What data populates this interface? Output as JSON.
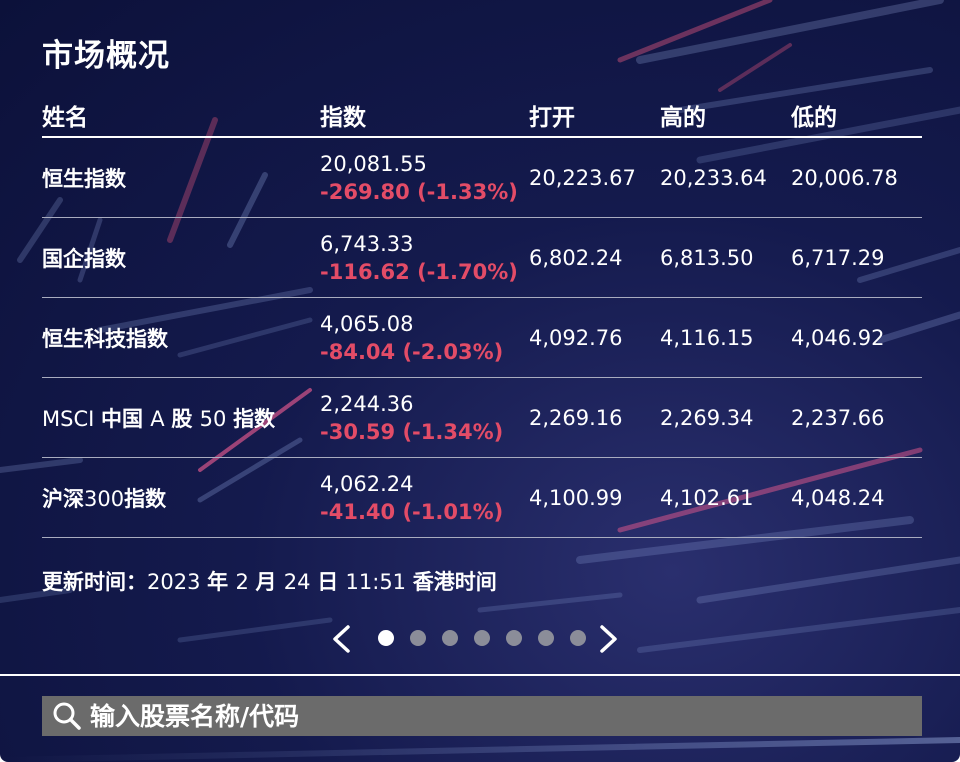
{
  "title": "市场概况",
  "columns": {
    "name": "姓名",
    "index": "指数",
    "open": "打开",
    "high": "高的",
    "low": "低的"
  },
  "rows": [
    {
      "name_cn": "恒生指数",
      "name_lat": "",
      "name_tail": "",
      "value": "20,081.55",
      "change": "-269.80 (-1.33%)",
      "open": "20,223.67",
      "high": "20,233.64",
      "low": "20,006.78"
    },
    {
      "name_cn": "国企指数",
      "name_lat": "",
      "name_tail": "",
      "value": "6,743.33",
      "change": "-116.62 (-1.70%)",
      "open": "6,802.24",
      "high": "6,813.50",
      "low": "6,717.29"
    },
    {
      "name_cn": "恒生科技指数",
      "name_lat": "",
      "name_tail": "",
      "value": "4,065.08",
      "change": "-84.04 (-2.03%)",
      "open": "4,092.76",
      "high": "4,116.15",
      "low": "4,046.92"
    },
    {
      "name_cn": "",
      "name_lat": "MSCI ",
      "name_mid": "中国 ",
      "name_lat2": "A ",
      "name_mid2": "股 ",
      "name_lat3": "50 ",
      "name_tail": "指数",
      "value": "2,244.36",
      "change": "-30.59 (-1.34%)",
      "open": "2,269.16",
      "high": "2,269.34",
      "low": "2,237.66"
    },
    {
      "name_cn": "沪深",
      "name_lat": "300",
      "name_tail": "指数",
      "value": "4,062.24",
      "change": "-41.40 (-1.01%)",
      "open": "4,100.99",
      "high": "4,102.61",
      "low": "4,048.24"
    }
  ],
  "updated": {
    "label": "更新时间：",
    "year": "2023 ",
    "year_unit": "年 ",
    "month": "2 ",
    "month_unit": "月 ",
    "day": "24 ",
    "day_unit": "日 ",
    "time": "11:51 ",
    "tz": "香港时间"
  },
  "pager": {
    "total": 7,
    "active": 1
  },
  "search": {
    "placeholder": "输入股票名称/代码"
  },
  "colors": {
    "negative": "#e34c67",
    "background": "#141a4d",
    "search_bg": "#6b6b6b"
  },
  "icons": {
    "prev": "chevron-left-icon",
    "next": "chevron-right-icon",
    "search": "search-icon"
  }
}
